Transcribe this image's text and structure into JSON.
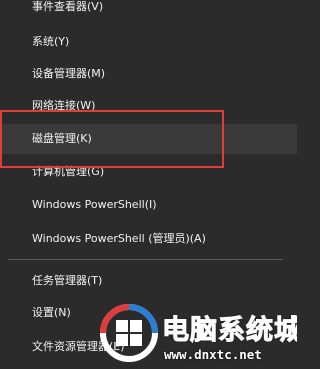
{
  "menu": {
    "items": [
      {
        "label": "事件查看器(V)"
      },
      {
        "label": "系统(Y)"
      },
      {
        "label": "设备管理器(M)"
      },
      {
        "label": "网络连接(W)"
      },
      {
        "label": "磁盘管理(K)"
      },
      {
        "label": "计算机管理(G)"
      },
      {
        "label": "Windows PowerShell(I)"
      },
      {
        "label": "Windows PowerShell (管理员)(A)"
      },
      {
        "label": "任务管理器(T)"
      },
      {
        "label": "设置(N)"
      },
      {
        "label": "文件资源管理器(E)"
      }
    ],
    "highlighted_item": "磁盘管理(K)"
  },
  "watermark": {
    "title": "电脑系统城",
    "url": "www.dnxtc.net",
    "logo_icon": "windows-logo-icon"
  },
  "colors": {
    "background": "#2b2b2b",
    "text": "#f2f2f2",
    "highlight_border": "#e03c3c",
    "separator": "#5a5a5a",
    "logo_blue": "#2a7fd4",
    "logo_red": "#e03c3c"
  }
}
